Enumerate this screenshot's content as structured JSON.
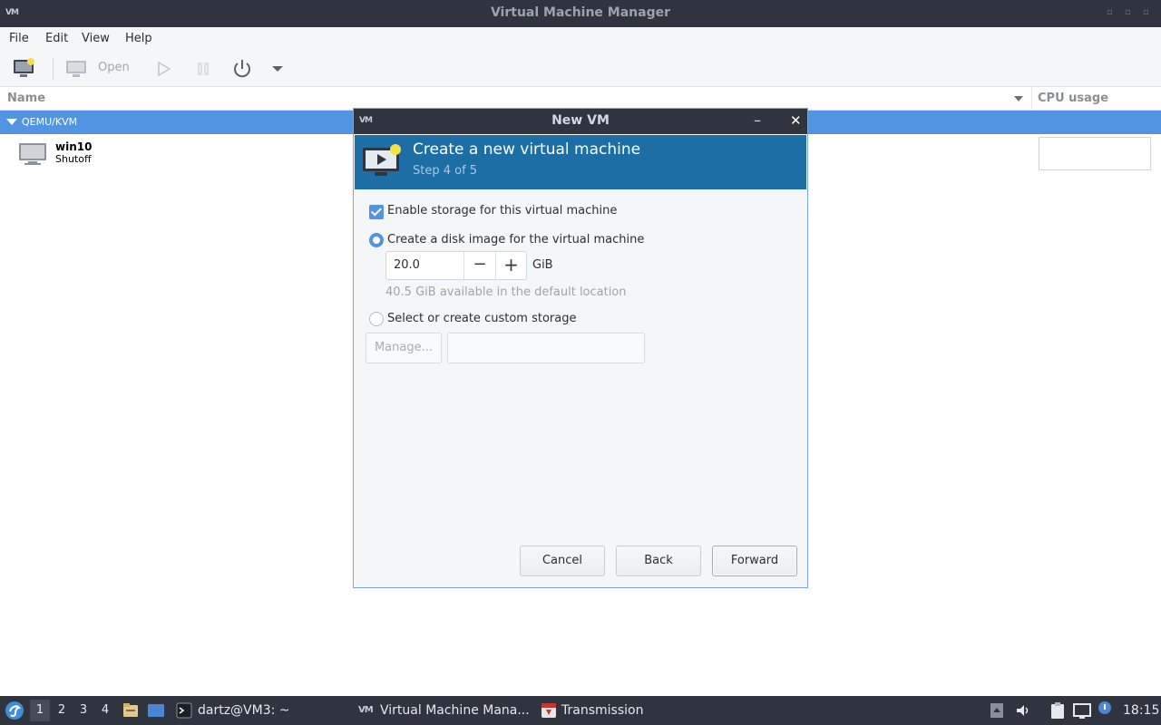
{
  "window": {
    "title": "Virtual Machine Manager",
    "app_icon_text": "VM"
  },
  "menubar": {
    "items": [
      "File",
      "Edit",
      "View",
      "Help"
    ]
  },
  "toolbar": {
    "open_label": "Open"
  },
  "list": {
    "columns": {
      "name": "Name",
      "cpu": "CPU usage"
    },
    "group": "QEMU/KVM",
    "vms": [
      {
        "name": "win10",
        "state": "Shutoff"
      }
    ]
  },
  "dialog": {
    "title": "New VM",
    "heading": "Create a new virtual machine",
    "step": "Step 4 of 5",
    "enable_storage_label": "Enable storage for this virtual machine",
    "enable_storage_checked": true,
    "create_disk_label": "Create a disk image for the virtual machine",
    "disk_size": "20.0",
    "disk_unit": "GiB",
    "available_text": "40.5 GiB available in the default location",
    "custom_storage_label": "Select or create custom storage",
    "manage_label": "Manage...",
    "custom_storage_path": "",
    "selected_option": "create_disk",
    "buttons": {
      "cancel": "Cancel",
      "back": "Back",
      "forward": "Forward"
    }
  },
  "taskbar": {
    "workspaces": [
      "1",
      "2",
      "3",
      "4"
    ],
    "active_workspace": "1",
    "tasks": [
      {
        "label": "dartz@VM3: ~",
        "icon": "terminal-icon"
      },
      {
        "label": "Virtual Machine Mana...",
        "icon": "virt-manager-icon"
      },
      {
        "label": "Transmission",
        "icon": "transmission-icon"
      }
    ],
    "clock": "18:15"
  },
  "colors": {
    "accent": "#5294e2",
    "titlebar": "#2f343f",
    "banner": "#1c6ea4"
  }
}
